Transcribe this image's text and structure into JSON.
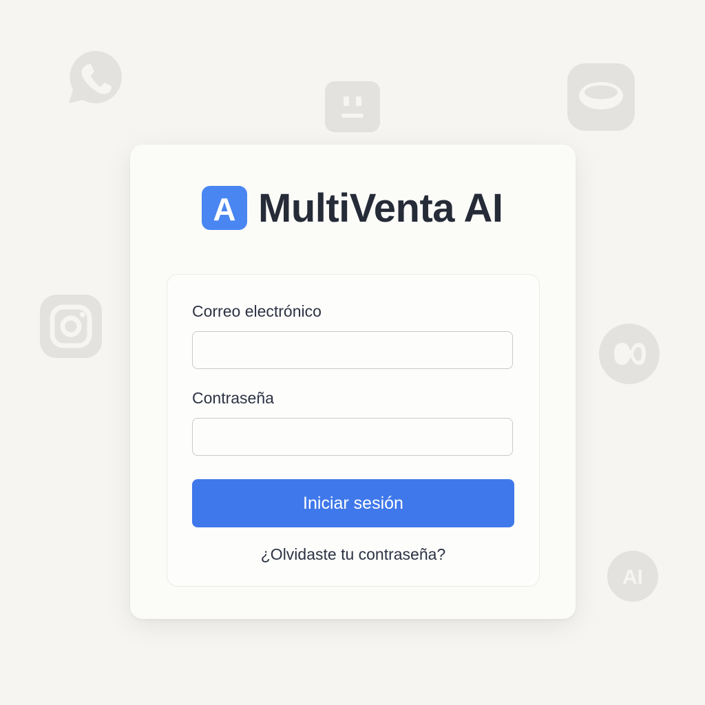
{
  "brand": {
    "name": "MultiVenta AI",
    "logo_letter": "A",
    "accent": "#4a86f1"
  },
  "form": {
    "email_label": "Correo electrónico",
    "email_value": "",
    "password_label": "Contraseña",
    "password_value": "",
    "submit_label": "Iniciar sesión",
    "forgot_link": "¿Olvidaste tu contraseña?"
  },
  "colors": {
    "button": "#3f78ea",
    "text": "#2c3243",
    "background": "#f6f5f1"
  },
  "background_icons": [
    "whatsapp-icon",
    "chat-bot-icon",
    "messenger-icon",
    "instagram-icon",
    "meta-icon",
    "ai-badge-icon"
  ],
  "ai_badge_text": "AI"
}
